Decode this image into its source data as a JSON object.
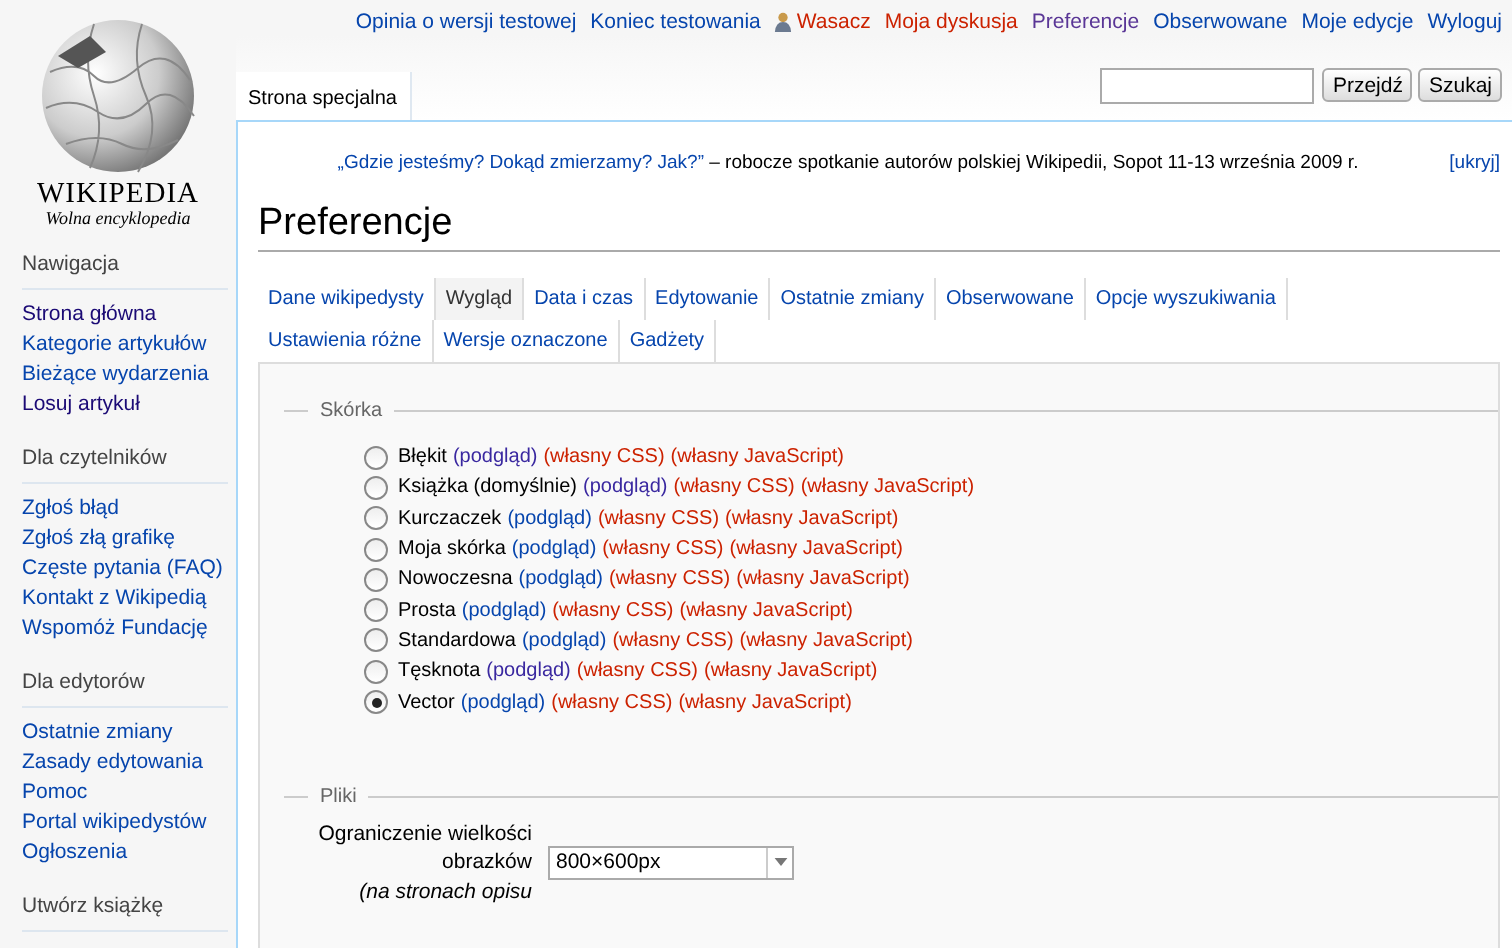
{
  "logo": {
    "wordmark": "WIKIPEDIA",
    "tagline": "Wolna encyklopedia"
  },
  "personal_links": [
    {
      "label": "Opinia o wersji testowej",
      "kind": "link"
    },
    {
      "label": "Koniec testowania",
      "kind": "link"
    },
    {
      "label": "Wasacz",
      "kind": "user"
    },
    {
      "label": "Moja dyskusja",
      "kind": "new"
    },
    {
      "label": "Preferencje",
      "kind": "visited"
    },
    {
      "label": "Obserwowane",
      "kind": "link"
    },
    {
      "label": "Moje edycje",
      "kind": "link"
    },
    {
      "label": "Wyloguj",
      "kind": "link"
    }
  ],
  "page_tab": "Strona specjalna",
  "search": {
    "go_button": "Przejdź",
    "search_button": "Szukaj"
  },
  "sidebar": [
    {
      "heading": "Nawigacja",
      "items": [
        {
          "label": "Strona główna",
          "visited": true
        },
        {
          "label": "Kategorie artykułów",
          "visited": false
        },
        {
          "label": "Bieżące wydarzenia",
          "visited": false
        },
        {
          "label": "Losuj artykuł",
          "visited": true
        }
      ]
    },
    {
      "heading": "Dla czytelników",
      "items": [
        {
          "label": "Zgłoś błąd",
          "visited": false
        },
        {
          "label": "Zgłoś złą grafikę",
          "visited": false
        },
        {
          "label": "Częste pytania (FAQ)",
          "visited": false
        },
        {
          "label": "Kontakt z Wikipedią",
          "visited": false
        },
        {
          "label": "Wspomóż Fundację",
          "visited": false
        }
      ]
    },
    {
      "heading": "Dla edytorów",
      "items": [
        {
          "label": "Ostatnie zmiany",
          "visited": false
        },
        {
          "label": "Zasady edytowania",
          "visited": false
        },
        {
          "label": "Pomoc",
          "visited": false
        },
        {
          "label": "Portal wikipedystów",
          "visited": false
        },
        {
          "label": "Ogłoszenia",
          "visited": false
        }
      ]
    },
    {
      "heading": "Utwórz książkę"
    }
  ],
  "banner": {
    "link": "„Gdzie jesteśmy? Dokąd zmierzamy? Jak?”",
    "text": " – robocze spotkanie autorów polskiej Wikipedii, Sopot 11-13 września 2009 r.",
    "hide": "[ukryj]"
  },
  "title": "Preferencje",
  "tabs": [
    {
      "label": "Dane wikipedysty",
      "selected": false
    },
    {
      "label": "Wygląd",
      "selected": true
    },
    {
      "label": "Data i czas",
      "selected": false
    },
    {
      "label": "Edytowanie",
      "selected": false
    },
    {
      "label": "Ostatnie zmiany",
      "selected": false
    },
    {
      "label": "Obserwowane",
      "selected": false
    },
    {
      "label": "Opcje wyszukiwania",
      "selected": false
    },
    {
      "label": "Ustawienia różne",
      "selected": false
    },
    {
      "label": "Wersje oznaczone",
      "selected": false
    },
    {
      "label": "Gadżety",
      "selected": false
    }
  ],
  "skin_section": {
    "legend": "Skórka",
    "skins": [
      {
        "name": "Błękit",
        "preview": "(podgląd)",
        "preview_visited": true,
        "css": "(własny CSS)",
        "js": "(własny JavaScript)",
        "selected": false
      },
      {
        "name": "Książka (domyślnie)",
        "preview": "(podgląd)",
        "preview_visited": true,
        "css": "(własny CSS)",
        "js": "(własny JavaScript)",
        "selected": false
      },
      {
        "name": "Kurczaczek",
        "preview": "(podgląd)",
        "preview_visited": false,
        "css": "(własny CSS)",
        "js": "(własny JavaScript)",
        "selected": false
      },
      {
        "name": "Moja skórka",
        "preview": "(podgląd)",
        "preview_visited": false,
        "css": "(własny CSS)",
        "js": "(własny JavaScript)",
        "selected": false
      },
      {
        "name": "Nowoczesna",
        "preview": "(podgląd)",
        "preview_visited": false,
        "css": "(własny CSS)",
        "js": "(własny JavaScript)",
        "selected": false
      },
      {
        "name": "Prosta",
        "preview": "(podgląd)",
        "preview_visited": false,
        "css": "(własny CSS)",
        "js": "(własny JavaScript)",
        "selected": false
      },
      {
        "name": "Standardowa",
        "preview": "(podgląd)",
        "preview_visited": false,
        "css": "(własny CSS)",
        "js": "(własny JavaScript)",
        "selected": false
      },
      {
        "name": "Tęsknota",
        "preview": "(podgląd)",
        "preview_visited": true,
        "css": "(własny CSS)",
        "js": "(własny JavaScript)",
        "selected": false
      },
      {
        "name": "Vector",
        "preview": "(podgląd)",
        "preview_visited": false,
        "css": "(własny CSS)",
        "js": "(własny JavaScript)",
        "selected": true
      }
    ]
  },
  "files_section": {
    "legend": "Pliki",
    "label": "Ograniczenie wielkości obrazków",
    "note": "(na stronach opisu",
    "value": "800×600px"
  }
}
